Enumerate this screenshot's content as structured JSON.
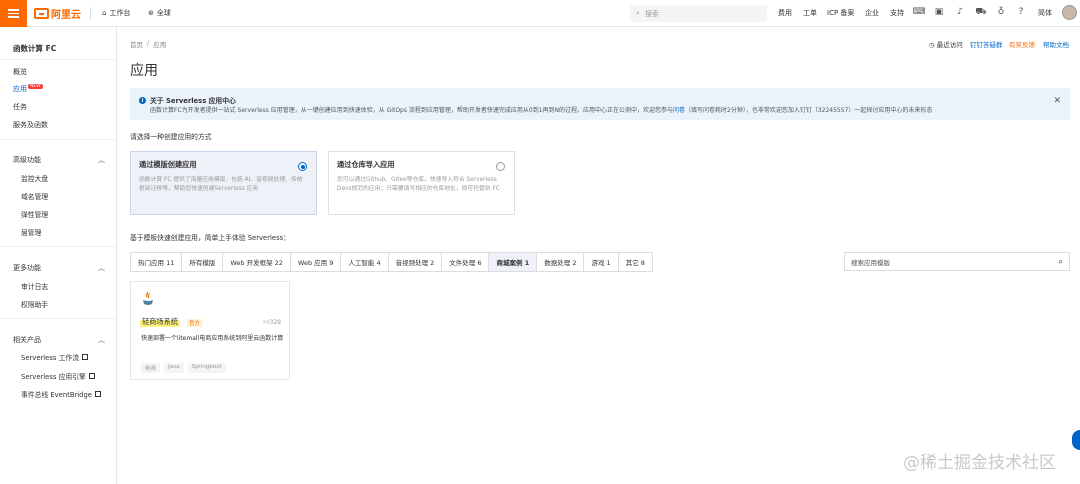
{
  "topbar": {
    "logo_text": "阿里云",
    "workbench": "工作台",
    "region": "全球",
    "search_placeholder": "搜索",
    "links": [
      "费用",
      "工单",
      "ICP 备案",
      "企业",
      "支持"
    ],
    "lang": "简体",
    "accent_color": "#ff6a00"
  },
  "sidebar": {
    "title": "函数计算 FC",
    "items": [
      "概览",
      "应用",
      "任务",
      "服务及函数"
    ],
    "new_badge": "NEW",
    "advanced": {
      "label": "高级功能",
      "items": [
        "监控大盘",
        "域名管理",
        "弹性管理",
        "层管理"
      ]
    },
    "more": {
      "label": "更多功能",
      "items": [
        "审计日志",
        "权限助手"
      ]
    },
    "related": {
      "label": "相关产品",
      "items": [
        "Serverless 工作流",
        "Serverless 应用引擎",
        "事件总线 EventBridge"
      ]
    }
  },
  "main": {
    "breadcrumb": [
      "首页",
      "/",
      "应用"
    ],
    "title": "应用",
    "header_links": [
      "最近访问",
      "钉钉答疑群",
      "有奖反馈",
      "帮助文档"
    ],
    "info": {
      "title": "关于 Serverless 应用中心",
      "desc_a": "函数计算FC为开发者提供一站式 Serverless 应用管理，从一键创建应用到快速体验，从 GitOps 流程到应用管理，帮助开发者快速完成应用从0到1再到N的过程。应用中心正在公测中，欢迎您参与",
      "desc_link": "问卷",
      "desc_b": "（填写问卷耗时2分钟），也非常欢迎您加入钉钉（32245557）一起探讨应用中心的未来形态"
    },
    "way_label": "请选择一种创建应用的方式",
    "ways": [
      {
        "title": "通过模版创建应用",
        "desc": "函数计算 FC 提供了海量应用模版，包括 AI、音视频处理、传统框架迁移等，帮助您快速创建Serverless 应用"
      },
      {
        "title": "通过仓库导入应用",
        "desc": "您可以通过Github、Gitee等仓库，快速导入符合 Serverless Devs规范的应用；只需要填写相应的仓库地址，即可托管到 FC"
      }
    ],
    "template_label": "基于模板快速创建应用，简单上手体验 Serverless：",
    "tabs": [
      "热门应用 11",
      "所有模版",
      "Web 开发框架 22",
      "Web 应用 9",
      "人工智能 4",
      "音视频处理 2",
      "文件处理 6",
      "商城案例 1",
      "数据处理 2",
      "游戏 1",
      "其它 8"
    ],
    "active_tab": "商城案例 1",
    "template_search_placeholder": "搜索应用模版",
    "card": {
      "name": "轻商场系统",
      "official": "官方",
      "likes": "329",
      "desc": "快速部署一个litemall电商应用系统到阿里云函数计算",
      "tags": [
        "电商",
        "Java",
        "Springboot"
      ],
      "icon": "java-icon"
    }
  },
  "watermark": "@稀土掘金技术社区"
}
